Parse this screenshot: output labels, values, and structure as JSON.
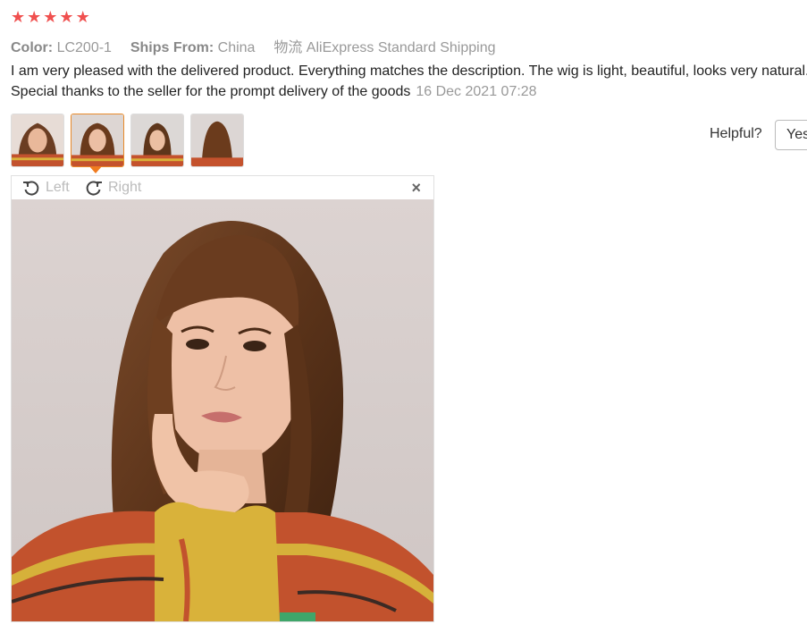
{
  "rating": {
    "stars": 5,
    "icon": "star-icon",
    "color": "#f0504f"
  },
  "meta": {
    "color_label": "Color:",
    "color_value": "LC200-1",
    "ships_label": "Ships From:",
    "ships_value": "China",
    "shipping_method": "物流 AliExpress Standard Shipping"
  },
  "review": {
    "text": "I am very pleased with the delivered product. Everything matches the description. The wig is light, beautiful, looks very natural. Special thanks to the seller for the prompt delivery of the goods",
    "date": "16 Dec 2021 07:28"
  },
  "helpful": {
    "label": "Helpful?",
    "yes_label": "Yes"
  },
  "viewer": {
    "rotate_left_label": "Left",
    "rotate_right_label": "Right",
    "close_label": "×",
    "rotate_left_icon": "rotate-left-icon",
    "rotate_right_icon": "rotate-right-icon"
  },
  "thumbnails": {
    "count": 4,
    "active_index": 1,
    "active_border_color": "#e88a2a"
  }
}
